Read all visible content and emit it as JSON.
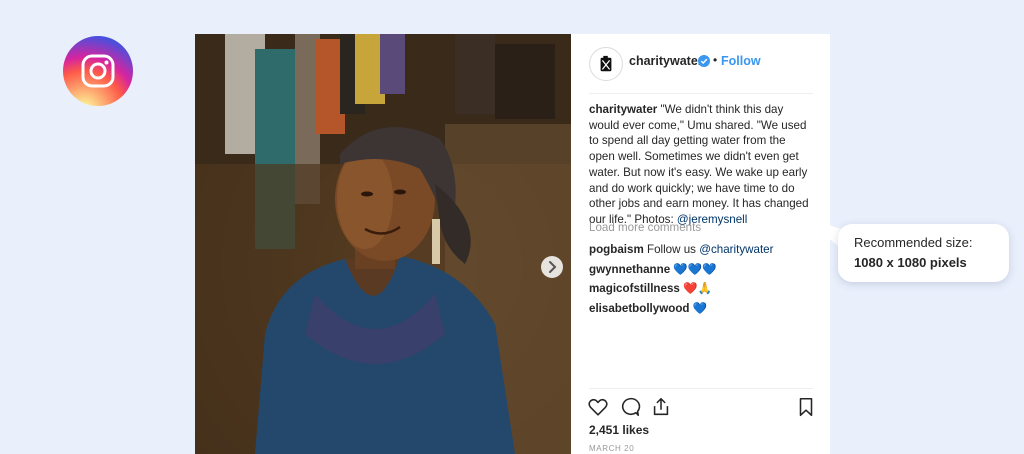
{
  "post": {
    "username": "charitywater",
    "separator": "•",
    "follow_label": "Follow",
    "caption": {
      "user": "charitywater",
      "text": " \"We didn't think this day would ever come,\" Umu shared. \"We used to spend all day getting water from the open well. Sometimes we didn't even get water. But now it's easy. We wake up early and do work quickly; we have time to do other jobs and earn money. It has changed our life.\" Photos: ",
      "mention": "@jeremysnell"
    },
    "load_more_label": "Load more comments",
    "comments": [
      {
        "user": "pogbaism",
        "text": "Follow us ",
        "mention": "@charitywater"
      },
      {
        "user": "gwynnethanne",
        "text": "💙💙💙",
        "mention": ""
      },
      {
        "user": "magicofstillness",
        "text": "❤️🙏",
        "mention": ""
      },
      {
        "user": "elisabetbollywood",
        "text": "💙",
        "mention": ""
      }
    ],
    "likes": "2,451 likes",
    "date": "MARCH 20"
  },
  "callout": {
    "line1": "Recommended size:",
    "line2": "1080 x 1080 pixels"
  },
  "icons": {
    "logo": "instagram-logo-icon",
    "verified": "verified-badge-icon",
    "next": "chevron-right-icon",
    "like": "heart-icon",
    "comment": "comment-bubble-icon",
    "share": "share-icon",
    "save": "bookmark-icon"
  },
  "colors": {
    "background": "#e9effb",
    "link": "#3897f0",
    "mention": "#003569",
    "muted": "#999999"
  }
}
